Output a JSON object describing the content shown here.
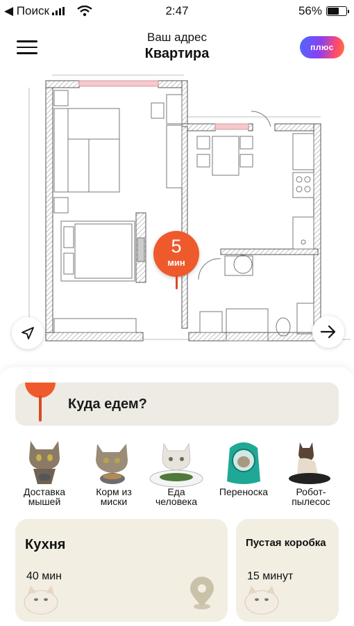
{
  "status_bar": {
    "carrier": "◀ Поиск",
    "time": "2:47",
    "battery_text": "56%",
    "battery_level": 0.56
  },
  "header": {
    "caption": "Ваш адрес",
    "title": "Квартира",
    "plus_label": "плюс"
  },
  "map": {
    "pin_value": "5",
    "pin_unit": "мин",
    "accent_color": "#ef5a2c"
  },
  "sheet": {
    "search_label": "Куда едем?",
    "services": [
      {
        "label_line1": "Доставка",
        "label_line2": "мышей"
      },
      {
        "label_line1": "Корм из",
        "label_line2": "миски"
      },
      {
        "label_line1": "Еда",
        "label_line2": "человека"
      },
      {
        "label_line1": "Переноска",
        "label_line2": ""
      },
      {
        "label_line1": "Робот-",
        "label_line2": "пылесос"
      }
    ],
    "cards": [
      {
        "title": "Кухня",
        "time": "40 мин"
      },
      {
        "title": "Пустая коробка",
        "time": "15 минут"
      }
    ]
  }
}
